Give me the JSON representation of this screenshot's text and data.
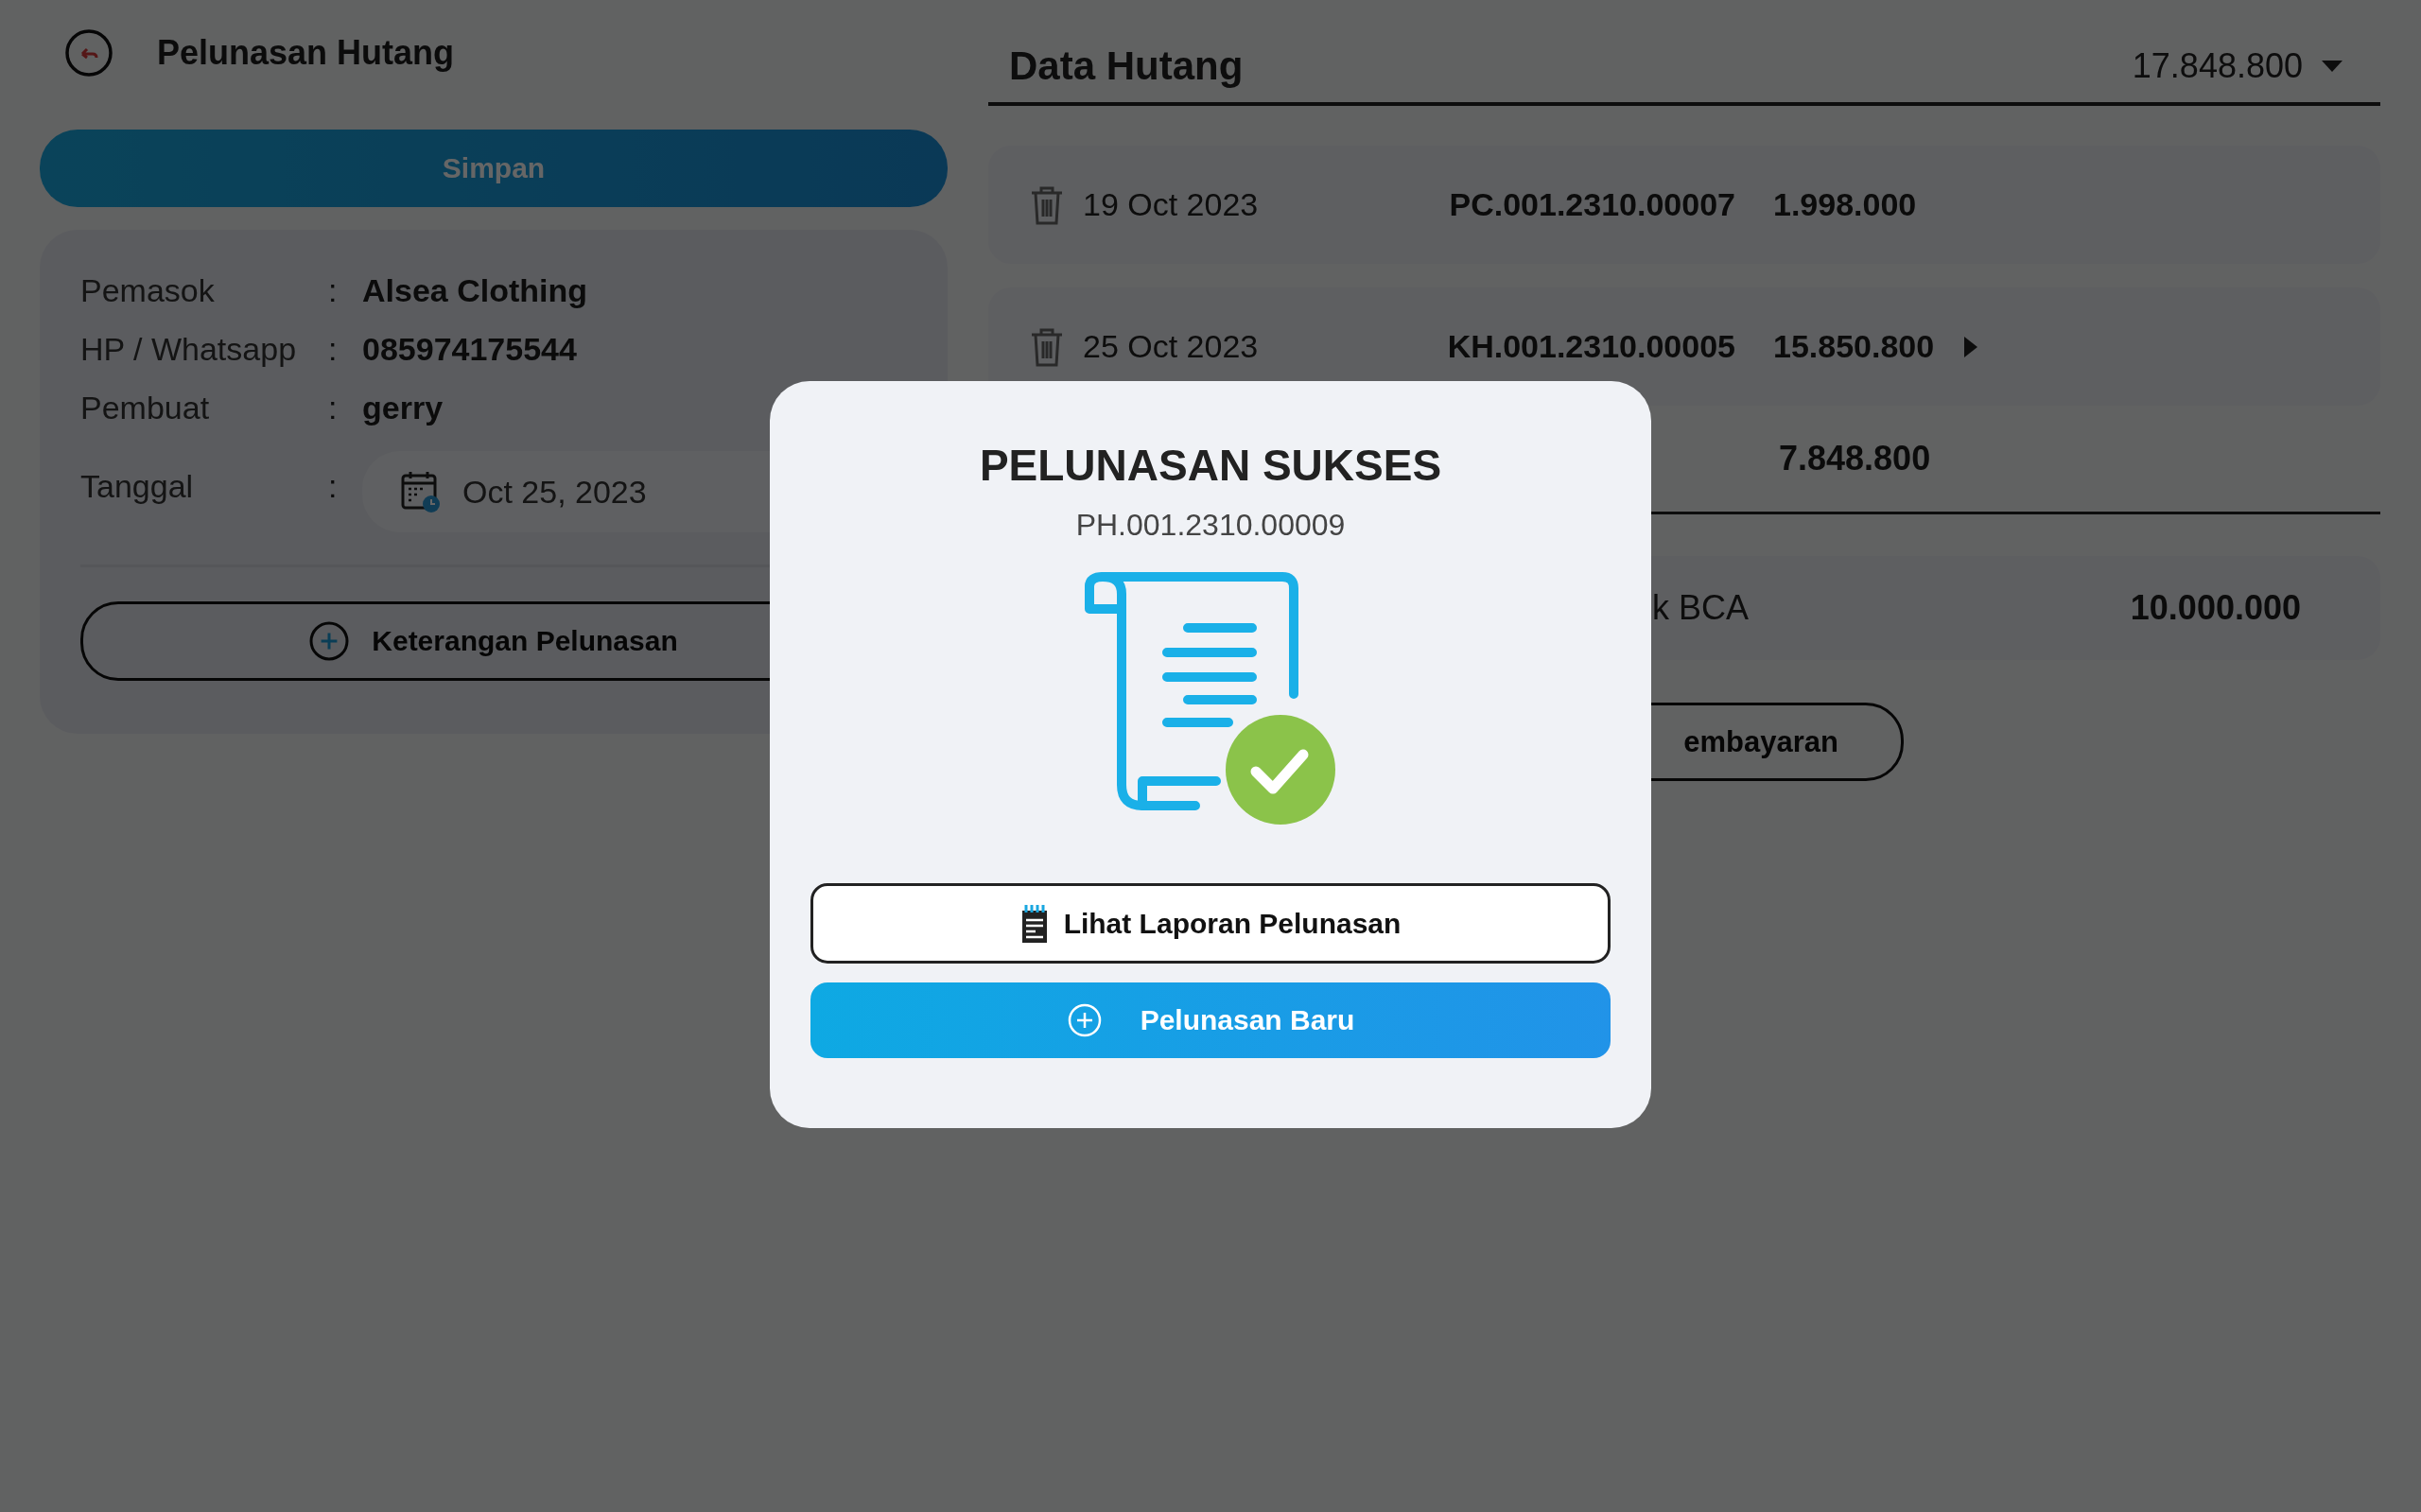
{
  "header": {
    "title": "Pelunasan Hutang"
  },
  "save_button": {
    "label": "Simpan"
  },
  "form": {
    "fields": [
      {
        "kind": "text",
        "label": "Pemasok",
        "separator": ":",
        "value": "Alsea Clothing"
      },
      {
        "kind": "text",
        "label": "HP / Whatsapp",
        "separator": ":",
        "value": "085974175544"
      },
      {
        "kind": "text",
        "label": "Pembuat",
        "separator": ":",
        "value": "gerry"
      },
      {
        "kind": "date",
        "label": "Tanggal",
        "separator": ":",
        "value": "Oct 25, 2023"
      }
    ],
    "notes_button": {
      "label": "Keterangan Pelunasan"
    }
  },
  "debts": {
    "title": "Data Hutang",
    "total": "17.848.800",
    "rows": [
      {
        "date": "19 Oct 2023",
        "code": "PC.001.2310.00007",
        "amount": "1.998.000",
        "has_detail": false
      },
      {
        "date": "25 Oct 2023",
        "code": "KH.001.2310.00005",
        "amount": "15.850.800",
        "has_detail": true
      }
    ],
    "summary": {
      "amount": "7.848.800"
    }
  },
  "payments": {
    "rows": [
      {
        "method": "k BCA",
        "amount": "10.000.000"
      }
    ],
    "add_button": {
      "label": "embayaran"
    }
  },
  "dialog": {
    "title": "PELUNASAN SUKSES",
    "code": "PH.001.2310.00009",
    "report_button": {
      "label": "Lihat Laporan Pelunasan"
    },
    "new_button": {
      "label": "Pelunasan Baru"
    }
  }
}
